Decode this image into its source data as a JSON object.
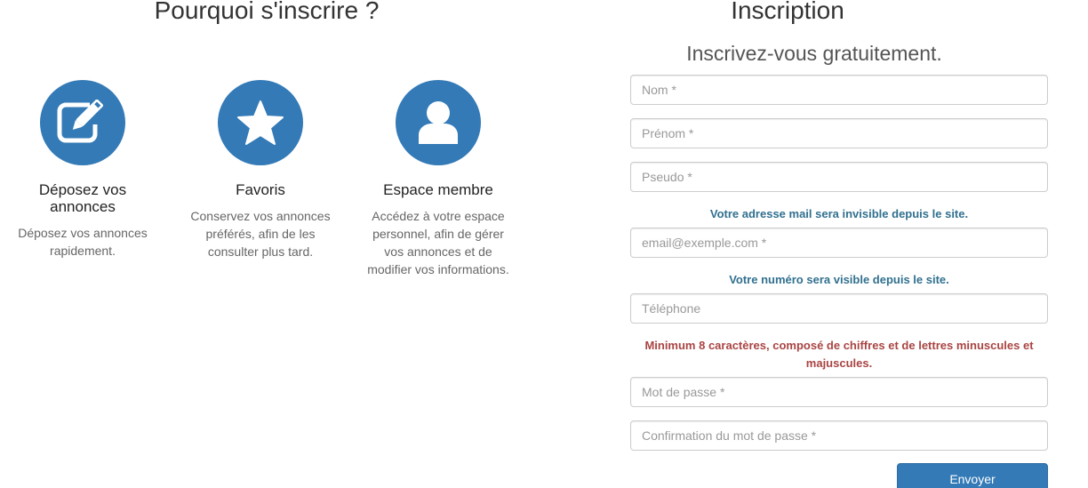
{
  "left": {
    "title": "Pourquoi s'inscrire ?",
    "features": [
      {
        "icon": "edit-icon",
        "title": "Déposez vos annonces",
        "text": "Déposez vos annonces rapidement."
      },
      {
        "icon": "star-icon",
        "title": "Favoris",
        "text": "Conservez vos annonces préférés, afin de les consulter plus tard."
      },
      {
        "icon": "user-icon",
        "title": "Espace membre",
        "text": "Accédez à votre espace personnel, afin de gérer vos annonces et de modifier vos informations."
      }
    ]
  },
  "form": {
    "title": "Inscription",
    "subtitle": "Inscrivez-vous gratuitement.",
    "nom_placeholder": "Nom *",
    "prenom_placeholder": "Prénom *",
    "pseudo_placeholder": "Pseudo *",
    "email_hint": "Votre adresse mail sera invisible depuis le site.",
    "email_placeholder": "email@exemple.com *",
    "phone_hint": "Votre numéro sera visible depuis le site.",
    "phone_placeholder": "Téléphone",
    "password_hint": "Minimum 8 caractères, composé de chiffres et de lettres minuscules et majuscules.",
    "password_placeholder": "Mot de passe *",
    "password_confirm_placeholder": "Confirmation du mot de passe *",
    "submit_label": "Envoyer"
  },
  "colors": {
    "primary": "#337ab7",
    "info_text": "#31708f",
    "warning_text": "#a94442"
  }
}
